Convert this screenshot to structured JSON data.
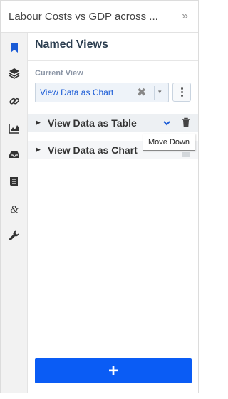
{
  "header": {
    "title": "Labour Costs vs GDP across ...",
    "collapse_glyph": "»"
  },
  "rail": {
    "icons": [
      "bookmark-icon",
      "layers-icon",
      "link-icon",
      "chart-icon",
      "inbox-icon",
      "document-icon",
      "ampersand-icon",
      "wrench-icon"
    ],
    "active_color": "#1a5bd6"
  },
  "panel": {
    "heading": "Named Views",
    "current_view_label": "Current View",
    "current_view_value": "View Data as Chart",
    "clear_glyph": "✖",
    "caret_glyph": "▾"
  },
  "views": [
    {
      "label": "View Data as Table",
      "expand_glyph": "▶"
    },
    {
      "label": "View Data as Chart",
      "expand_glyph": "▶"
    }
  ],
  "tooltip": {
    "text": "Move Down"
  },
  "add_button": {
    "glyph": "+",
    "color": "#0a5cf5"
  }
}
